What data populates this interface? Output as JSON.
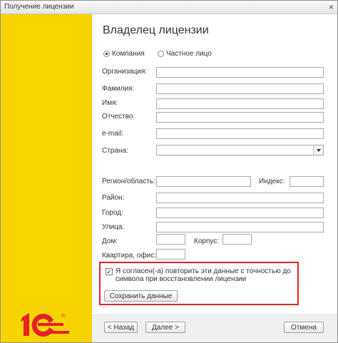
{
  "window": {
    "title": "Получение лицензии",
    "close": "×"
  },
  "logo": {
    "text": "1С",
    "colors": {
      "logo": "#e2212b",
      "sidebar": "#f7d400"
    }
  },
  "form": {
    "heading": "Владелец лицензии",
    "owner_type": {
      "options": [
        "Компания",
        "Частное лицо"
      ],
      "selected": "Компания"
    },
    "labels": {
      "organization": "Организация:",
      "surname": "Фамилия:",
      "name": "Имя:",
      "patronymic": "Отчество:",
      "email": "e-mail:",
      "country": "Страна:",
      "region": "Регион/область:",
      "index": "Индекс:",
      "district": "Район:",
      "city": "Город:",
      "street": "Улица:",
      "house": "Дом:",
      "building": "Корпус:",
      "apartment": "Квартира, офис:"
    },
    "values": {
      "organization": "",
      "surname": "",
      "name": "",
      "patronymic": "",
      "email": "",
      "country": "",
      "region": "",
      "index": "",
      "district": "",
      "city": "",
      "street": "",
      "house": "",
      "building": "",
      "apartment": ""
    },
    "agree": {
      "checked": true,
      "check_mark": "✓",
      "text": "Я согласен(-а) повторить эти данные с точностью до символа при восстановлении лицензии",
      "save_button": "Сохранить данные"
    }
  },
  "footer": {
    "back": "< Назад",
    "next": "Далее >",
    "cancel": "Отмена"
  }
}
